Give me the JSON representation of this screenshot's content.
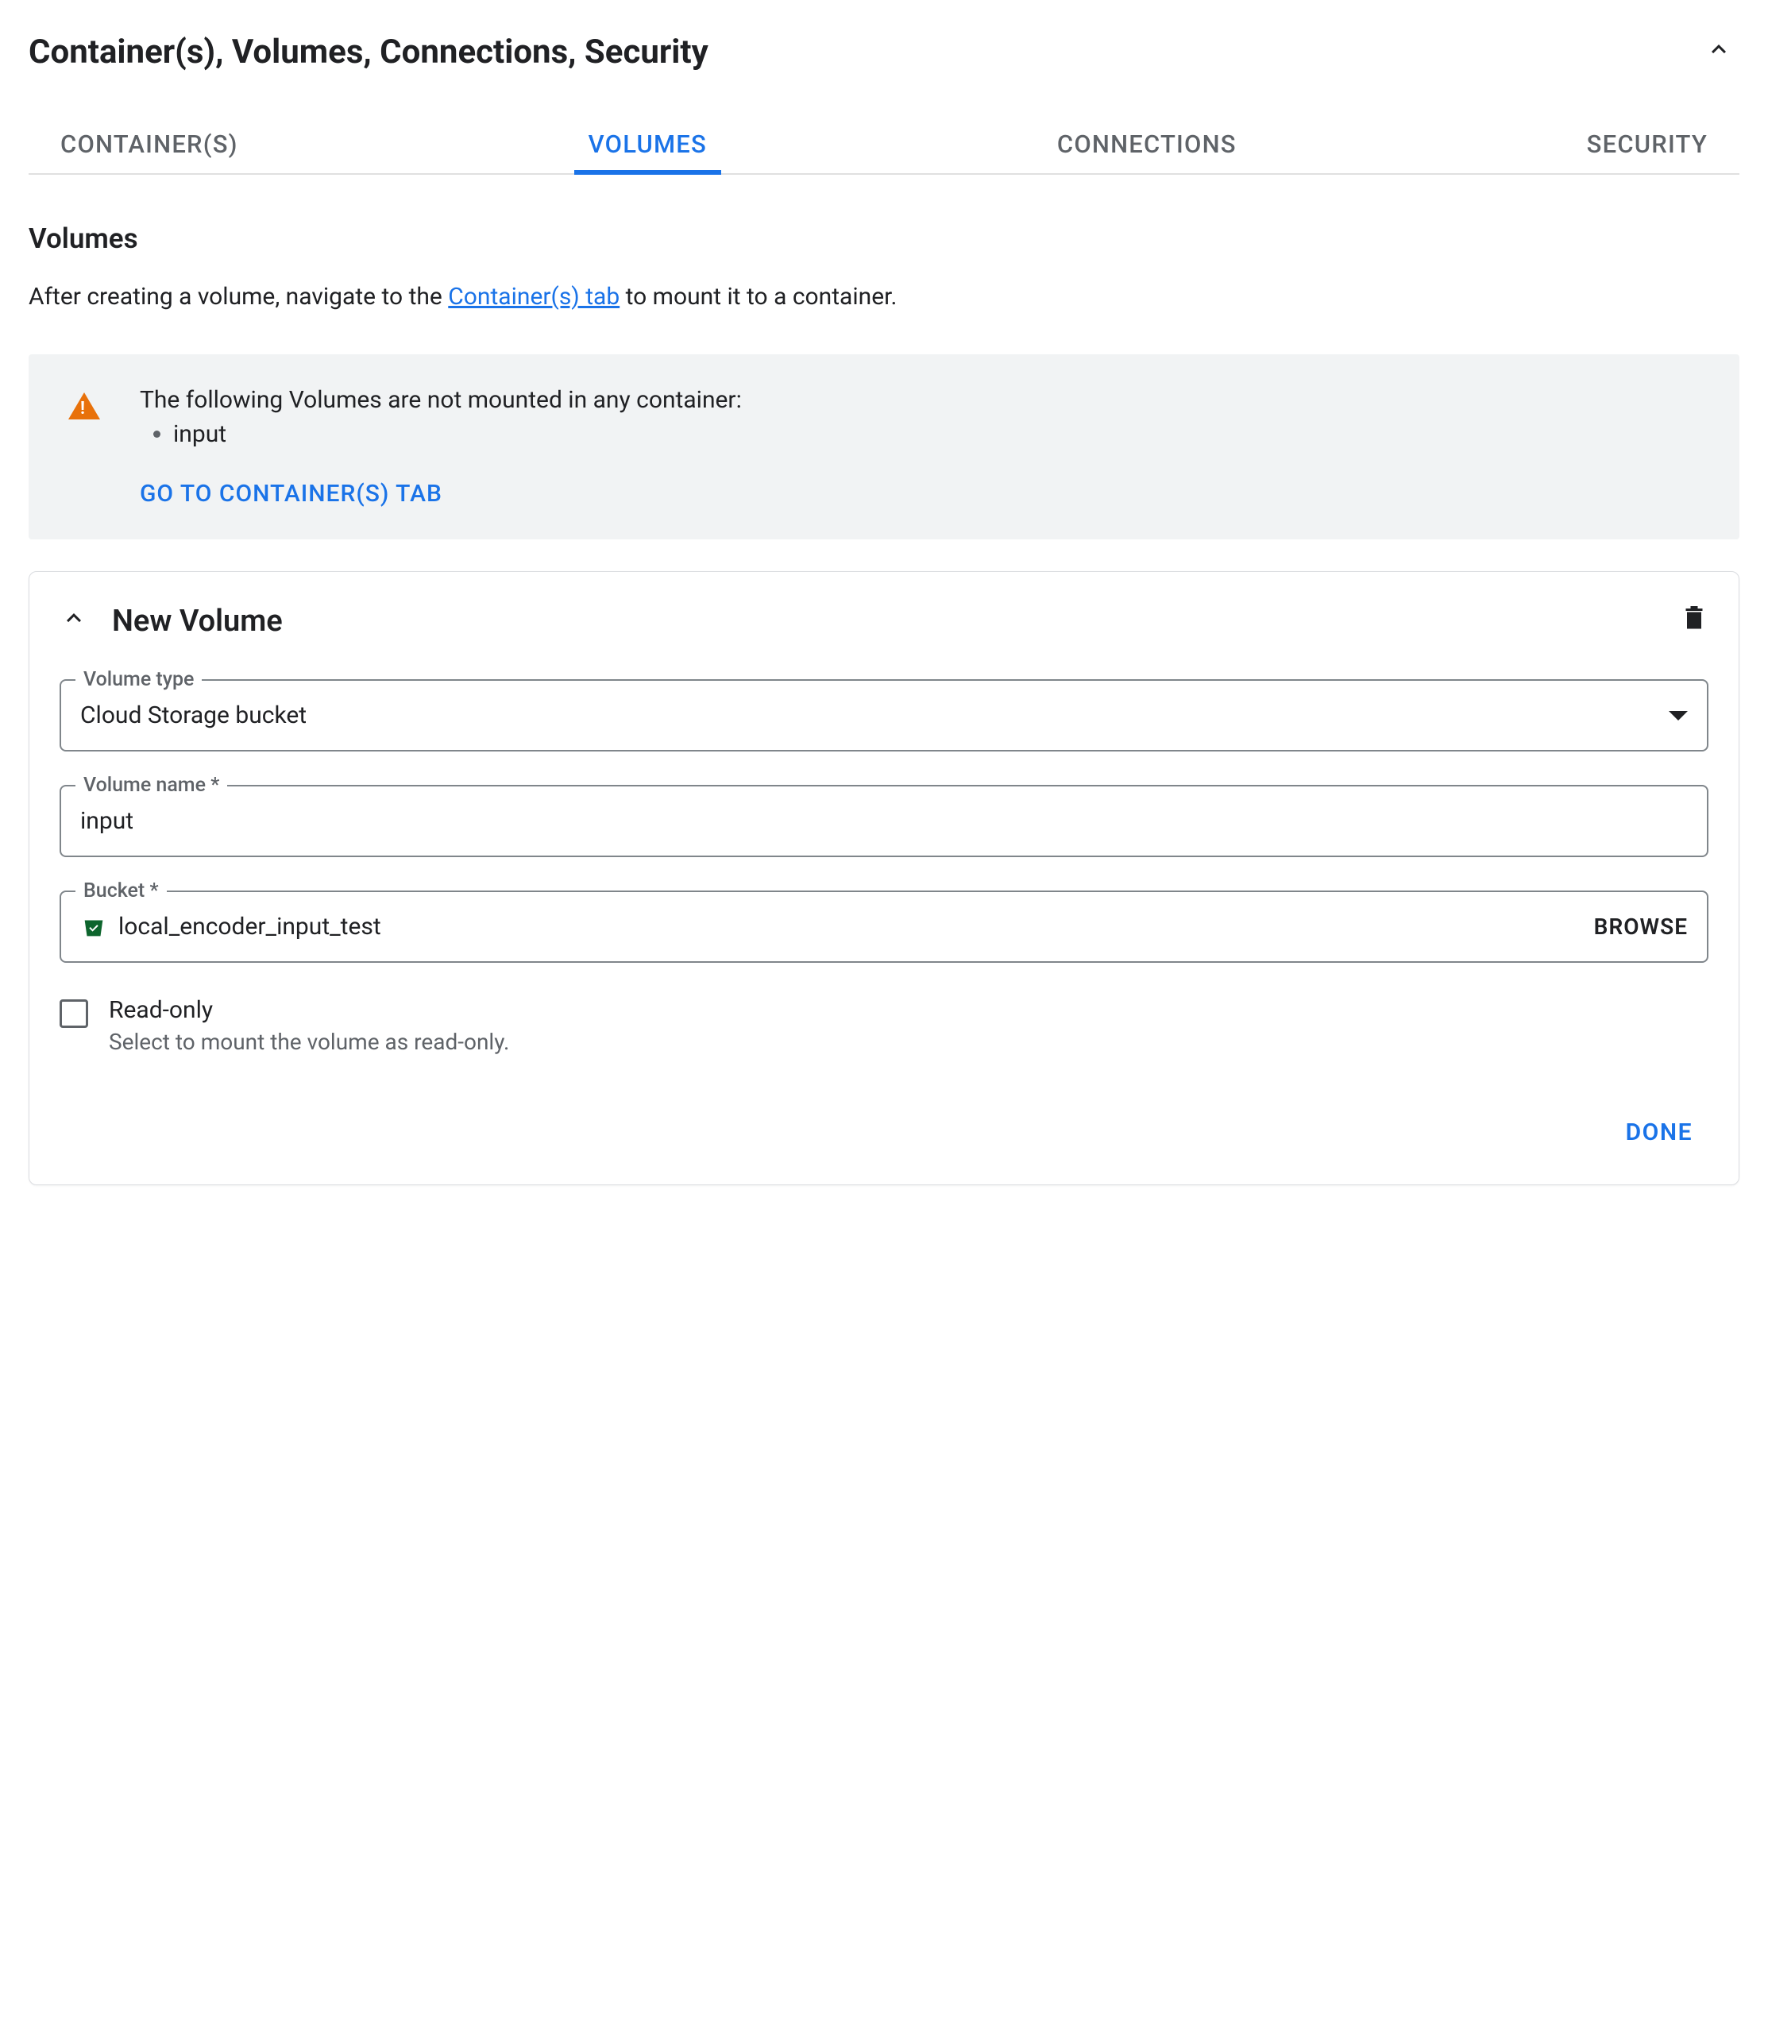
{
  "header": {
    "title": "Container(s), Volumes, Connections, Security"
  },
  "tabs": [
    {
      "label": "CONTAINER(S)"
    },
    {
      "label": "VOLUMES"
    },
    {
      "label": "CONNECTIONS"
    },
    {
      "label": "SECURITY"
    }
  ],
  "section": {
    "title": "Volumes",
    "description_pre": "After creating a volume, navigate to the ",
    "description_link": "Container(s) tab",
    "description_post": " to mount it to a container."
  },
  "warning": {
    "text": "The following Volumes are not mounted in any container:",
    "items": [
      "input"
    ],
    "action": "GO TO CONTAINER(S) TAB"
  },
  "card": {
    "title": "New Volume",
    "volume_type": {
      "label": "Volume type",
      "value": "Cloud Storage bucket"
    },
    "volume_name": {
      "label": "Volume name *",
      "value": "input"
    },
    "bucket": {
      "label": "Bucket *",
      "value": "local_encoder_input_test",
      "browse": "BROWSE"
    },
    "readonly": {
      "label": "Read-only",
      "helper": "Select to mount the volume as read-only."
    },
    "done": "DONE"
  }
}
